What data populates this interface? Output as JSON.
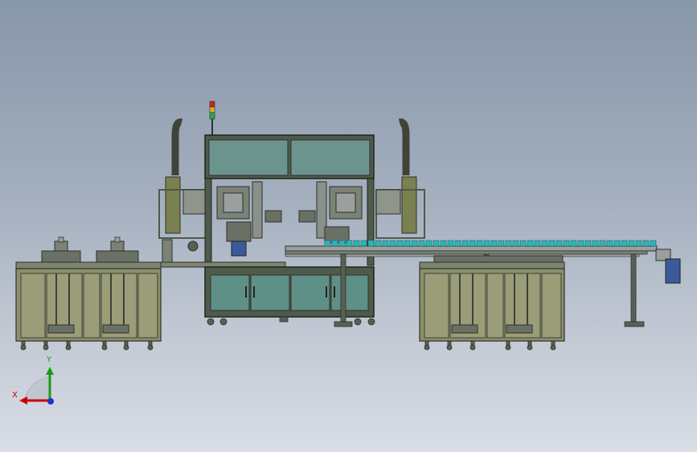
{
  "viewport": {
    "background_top": "#8796a9",
    "background_bottom": "#d9dde5"
  },
  "colors": {
    "frame": "#4f5a4a",
    "panel_olive": "#8c8f6c",
    "panel_teal": "#5f9088",
    "glass": "#6c948e",
    "metal": "#9aa0a0",
    "bottle": "#2fb3b8",
    "motor": "#3a5a9a"
  },
  "triad": {
    "x_label": "X",
    "y_label": "Y",
    "icon": "coordinate-triad-icon"
  }
}
